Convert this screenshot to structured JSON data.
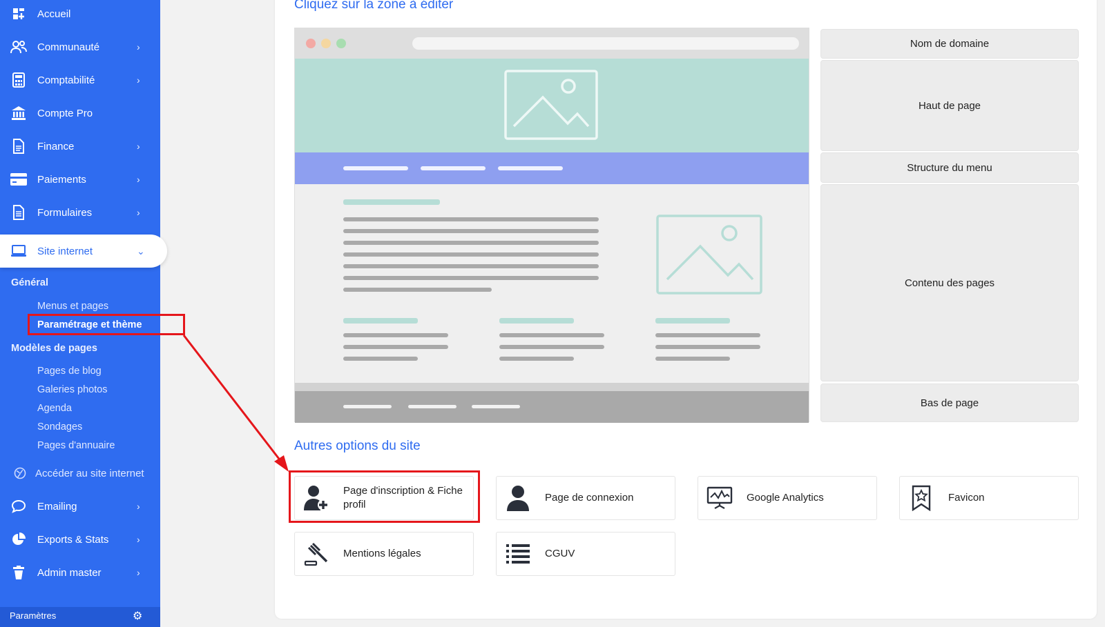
{
  "sidebar": {
    "items": [
      {
        "label": "Accueil",
        "icon": "dashboard-icon",
        "chevron": ""
      },
      {
        "label": "Communauté",
        "icon": "community-icon",
        "chevron": "›"
      },
      {
        "label": "Comptabilité",
        "icon": "calculator-icon",
        "chevron": "›"
      },
      {
        "label": "Compte Pro",
        "icon": "bank-icon",
        "chevron": ""
      },
      {
        "label": "Finance",
        "icon": "document-icon",
        "chevron": "›"
      },
      {
        "label": "Paiements",
        "icon": "credit-card-icon",
        "chevron": "›"
      },
      {
        "label": "Formulaires",
        "icon": "form-icon",
        "chevron": "›"
      },
      {
        "label": "Site internet",
        "icon": "laptop-icon",
        "chevron": "⌄"
      }
    ],
    "submenu": {
      "general_heading": "Général",
      "general_items": [
        "Menus et pages",
        "Paramétrage et thème"
      ],
      "models_heading": "Modèles de pages",
      "models_items": [
        "Pages de blog",
        "Galeries photos",
        "Agenda",
        "Sondages",
        "Pages d'annuaire"
      ],
      "visit_site": "Accéder au site internet"
    },
    "lower_items": [
      {
        "label": "Emailing",
        "icon": "chat-icon",
        "chevron": "›"
      },
      {
        "label": "Exports & Stats",
        "icon": "pie-chart-icon",
        "chevron": "›"
      },
      {
        "label": "Admin master",
        "icon": "admin-icon",
        "chevron": "›"
      }
    ],
    "footer_label": "Paramètres"
  },
  "main": {
    "edit_title": "Cliquez sur la zone à éditer",
    "zones": [
      "Nom de domaine",
      "Haut de page",
      "Structure du menu",
      "Contenu des pages",
      "Bas de page"
    ],
    "other_title": "Autres options du site",
    "options": [
      {
        "label": "Page d'inscription & Fiche profil",
        "icon": "add-user-icon"
      },
      {
        "label": "Page de connexion",
        "icon": "user-icon"
      },
      {
        "label": "Google Analytics",
        "icon": "analytics-monitor-icon"
      },
      {
        "label": "Favicon",
        "icon": "star-bookmark-icon"
      },
      {
        "label": "Mentions légales",
        "icon": "gavel-icon"
      },
      {
        "label": "CGUV",
        "icon": "list-icon"
      }
    ]
  },
  "colors": {
    "sidebar": "#2f6cf0",
    "accent": "#2f6cf0",
    "annotation": "#e5161b",
    "header_preview": "#b6ddd6",
    "menu_preview": "#8e9ff0"
  }
}
